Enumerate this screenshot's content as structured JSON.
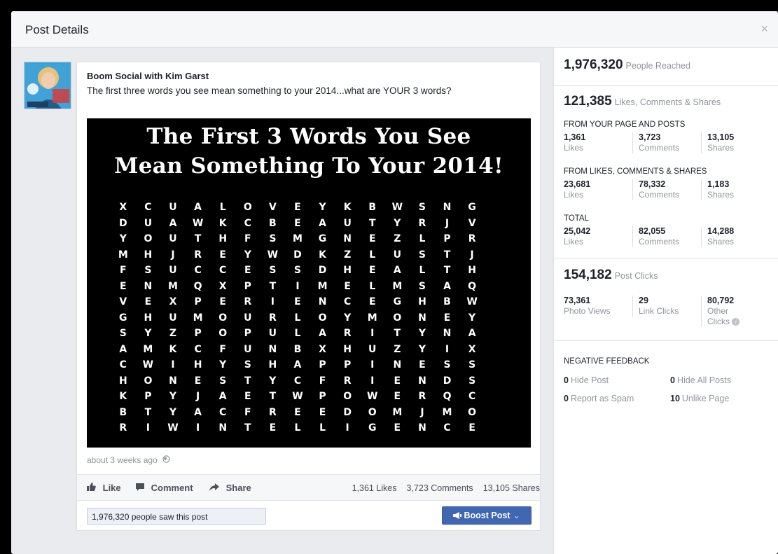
{
  "dialog": {
    "title": "Post Details",
    "close_glyph": "×"
  },
  "post": {
    "page_name": "Boom Social with Kim Garst",
    "text": "The first three words you see mean something to your 2014...what are YOUR 3 words?",
    "image": {
      "headline_line1": "The First 3 Words You See",
      "headline_line2": "Mean Something To Your 2014!",
      "grid_rows": [
        "XCUALOVEYKBWSNG",
        "DUAWKCBEAUTYRJV",
        "YOUTHFSMGNEZLPR",
        "MHJREYWDKZLUSTJ",
        "FSUCCESSDHEALTH",
        "ENMQXPTIMELMSAQ",
        "VEXPERIENCEGHBW",
        "GHUMOURLOYMONEY",
        "SYZPOPULARITYNA",
        "AMKCFUNBXHUZYIX",
        "CWIHYSHAPPINESS",
        "HONESTYCFRIENDS",
        "KPYJAETWPOWERQC",
        "BTYACFREEDOMJMO",
        "RIWINTELLIGENCE"
      ]
    },
    "timestamp": "about 3 weeks ago",
    "actions": {
      "like": "Like",
      "comment": "Comment",
      "share": "Share"
    },
    "counts": {
      "likes": "1,361 Likes",
      "comments": "3,723 Comments",
      "shares": "13,105 Shares"
    },
    "seen_text": "1,976,320 people saw this post",
    "boost_label": "Boost Post"
  },
  "stats": {
    "reached": {
      "value": "1,976,320",
      "label": "People Reached"
    },
    "engagement": {
      "value": "121,385",
      "label": "Likes, Comments & Shares"
    },
    "from_page": {
      "label": "FROM YOUR PAGE AND POSTS",
      "likes": "1,361",
      "comments": "3,723",
      "shares": "13,105"
    },
    "from_lcs": {
      "label": "FROM LIKES, COMMENTS & SHARES",
      "likes": "23,681",
      "comments": "78,332",
      "shares": "1,183"
    },
    "total": {
      "label": "TOTAL",
      "likes": "25,042",
      "comments": "82,055",
      "shares": "14,288"
    },
    "cell_labels": {
      "likes": "Likes",
      "comments": "Comments",
      "shares": "Shares"
    },
    "clicks": {
      "value": "154,182",
      "label": "Post Clicks",
      "photo_views": "73,361",
      "photo_views_label": "Photo Views",
      "link_clicks": "29",
      "link_clicks_label": "Link Clicks",
      "other_clicks": "80,792",
      "other_label_1": "Other",
      "other_label_2": "Clicks"
    },
    "negative": {
      "label": "NEGATIVE FEEDBACK",
      "hide_post_count": "0",
      "hide_post_label": "Hide Post",
      "hide_all_count": "0",
      "hide_all_label": "Hide All Posts",
      "spam_count": "0",
      "spam_label": "Report as Spam",
      "unlike_count": "10",
      "unlike_label": "Unlike Page"
    }
  },
  "colors": {
    "accent": "#4267b2",
    "muted": "#90949c",
    "text": "#1d2129"
  }
}
